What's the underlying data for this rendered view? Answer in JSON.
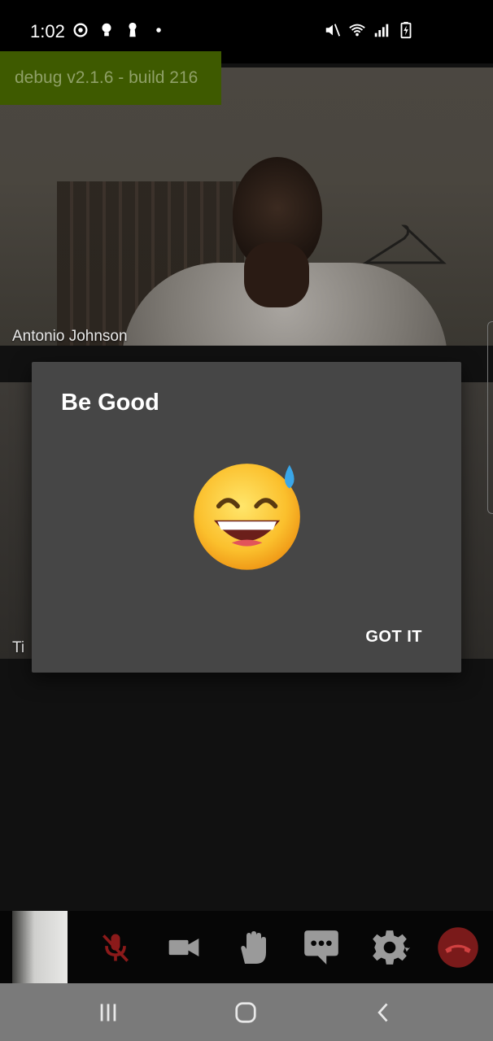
{
  "status_bar": {
    "time": "1:02",
    "left_icons": [
      "sync-icon",
      "bulb-icon",
      "keyhole-icon",
      "dot-icon"
    ],
    "right_icons": [
      "mute-icon",
      "wifi-icon",
      "signal-icon",
      "battery-charging-icon"
    ]
  },
  "debug_badge": {
    "label": "debug v2.1.6 - build 216"
  },
  "participants": [
    {
      "name": "Antonio Johnson"
    },
    {
      "name": "Ti"
    }
  ],
  "dialog": {
    "title": "Be Good",
    "emoji": "grinning-face-with-sweat-icon",
    "button_label": "GOT IT"
  },
  "toolbar": {
    "buttons": [
      {
        "icon": "mic-off-icon",
        "color": "#8b1a1a"
      },
      {
        "icon": "video-camera-icon",
        "color": "#9a9a9a"
      },
      {
        "icon": "raise-hand-icon",
        "color": "#9a9a9a"
      },
      {
        "icon": "chat-icon",
        "color": "#9a9a9a"
      },
      {
        "icon": "gear-icon",
        "color": "#9a9a9a"
      },
      {
        "icon": "end-call-icon",
        "color": "#7a1a1a"
      }
    ]
  },
  "nav_bar": {
    "buttons": [
      "recent-apps-icon",
      "home-icon",
      "back-icon"
    ]
  },
  "colors": {
    "debug_bg": "#3e5a00",
    "dialog_bg": "#464646",
    "nav_bg": "#7a7a7a"
  }
}
